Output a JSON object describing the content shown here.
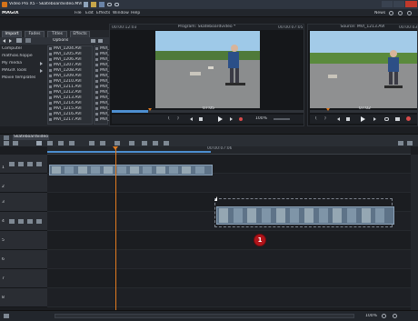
{
  "window": {
    "title": "Video Pro X5 - Skateboardvideo.MVP*"
  },
  "menu": {
    "items": [
      "File",
      "Edit",
      "Effects",
      "Window",
      "Help"
    ],
    "app_logo": "MAGIX",
    "news_label": "News"
  },
  "left_panel": {
    "tabs": [
      "Import",
      "Fades",
      "Titles",
      "Effects"
    ],
    "nav": [
      {
        "label": "Computer"
      },
      {
        "label": "mathias.hoppe"
      },
      {
        "label": "My media"
      },
      {
        "label": "MAGIX Tools"
      },
      {
        "label": "Movie templates"
      }
    ],
    "options_label": "Options",
    "files": [
      "MVI_1204.AVI",
      "MVI_1205.AVI",
      "MVI_1206.AVI",
      "MVI_1207.AVI",
      "MVI_1208.AVI",
      "MVI_1209.AVI",
      "MVI_1210.AVI",
      "MVI_1211.AVI",
      "MVI_1212.AVI",
      "MVI_1213.AVI",
      "MVI_1214.AVI",
      "MVI_1215.AVI",
      "MVI_1216.AVI",
      "MVI_1217.AVI"
    ],
    "files2": [
      "MVI_12",
      "MVI_12",
      "MVI_12",
      "MVI_12",
      "MVI_12",
      "MVI_12",
      "MVI_12",
      "MVI_12",
      "MVI_12",
      "MVI_12",
      "MVI_12",
      "MVI_12",
      "MVI_12",
      "MVI_12"
    ]
  },
  "program_monitor": {
    "title": "Program: Skateboardvideo *",
    "tc_left": "00:00:12:03",
    "tc_right": "00:00:07:05",
    "position_tc": "07:05",
    "zoom": "100%"
  },
  "source_monitor": {
    "title": "Source: MVI_1213.AVI",
    "tc_right": "00:00:03",
    "position_tc": "07:02"
  },
  "timeline": {
    "tab_label": "Skateboardvideo",
    "ruler_label": "00:00:07:06",
    "track_numbers": [
      "1",
      "2",
      "3",
      "4",
      "5",
      "6",
      "7",
      "8"
    ],
    "marker_label": "1",
    "zoom_label": "100%"
  },
  "colors": {
    "accent": "#e07a1f",
    "marker": "#b1141a",
    "clip": "#5e7388"
  }
}
